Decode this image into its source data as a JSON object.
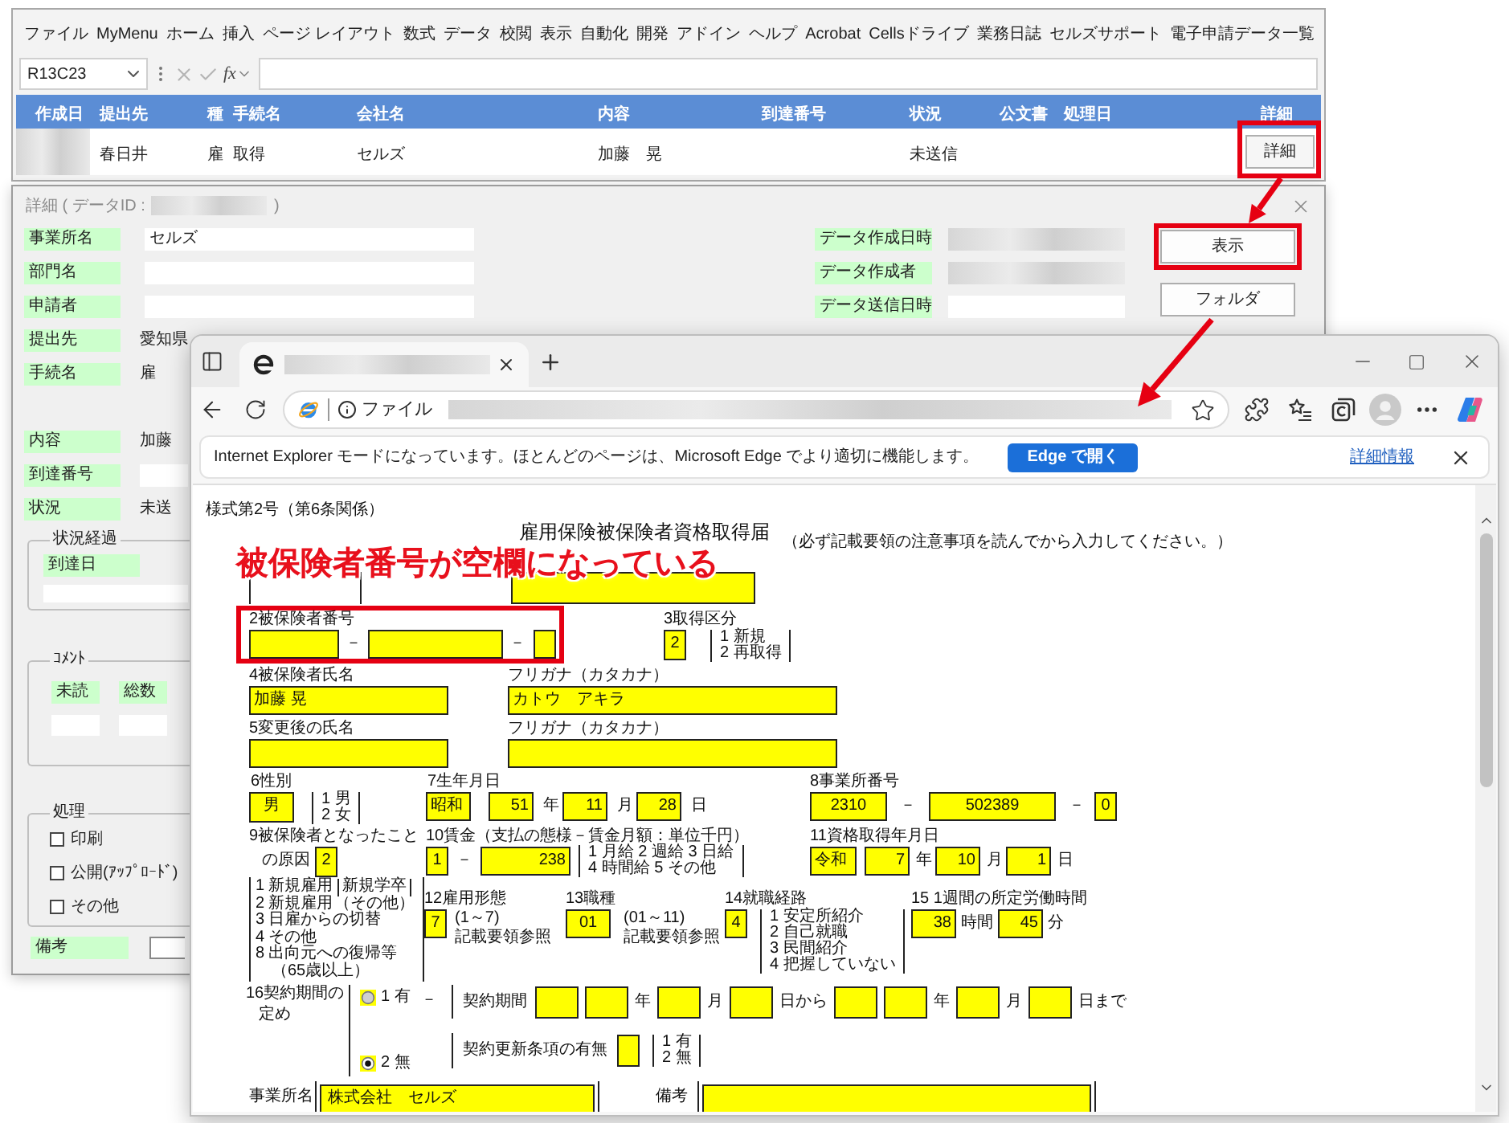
{
  "excel": {
    "menu": [
      "ファイル",
      "MyMenu",
      "ホーム",
      "挿入",
      "ページ レイアウト",
      "数式",
      "データ",
      "校閲",
      "表示",
      "自動化",
      "開発",
      "アドイン",
      "ヘルプ",
      "Acrobat",
      "Cellsドライブ",
      "業務日誌",
      "セルズサポート",
      "電子申請データ一覧"
    ],
    "name_box": "R13C23",
    "formula_label": "fx",
    "columns": [
      "作成日",
      "提出先",
      "種",
      "手続名",
      "会社名",
      "内容",
      "到達番号",
      "状況",
      "公文書",
      "処理日",
      "詳細"
    ],
    "rows": [
      {
        "submitted_to": "春日井",
        "type": "雇",
        "procedure": "取得",
        "company": "セルズ",
        "content": "加藤　晃",
        "status": "未送信",
        "detail_button": "詳細",
        "highlighted": true
      }
    ]
  },
  "detail_dialog": {
    "title": "詳細 ( データID :",
    "title_end": ")",
    "top_fields": [
      {
        "label": "事業所名",
        "value": "セルズ",
        "kind": "input"
      },
      {
        "label": "部門名",
        "kind": "input"
      },
      {
        "label": "申請者",
        "kind": "input"
      }
    ],
    "info_fields": [
      {
        "label": "データ作成日時",
        "kind": "blurred"
      },
      {
        "label": "データ作成者",
        "kind": "blurred"
      },
      {
        "label": "データ送信日時",
        "kind": "input"
      }
    ],
    "buttons": [
      {
        "label": "表示",
        "highlighted": true
      },
      {
        "label": "フォルダ",
        "highlighted": false
      }
    ],
    "field_groups": [
      [
        {
          "label": "提出先",
          "value": "愛知県",
          "kind": "text"
        },
        {
          "label": "手続名",
          "value": "雇",
          "kind": "text"
        }
      ],
      [
        {
          "label": "内容",
          "value": "加藤",
          "kind": "text"
        },
        {
          "label": "到達番号",
          "kind": "input"
        },
        {
          "label": "状況",
          "value": "未送",
          "kind": "text"
        }
      ]
    ],
    "status_history": {
      "title": "状況経過",
      "label": "到達日"
    },
    "comments": {
      "title": "ｺﾒﾝﾄ",
      "labels": [
        "未読",
        "総数"
      ]
    },
    "processing": {
      "title": "処理",
      "options": [
        {
          "label": "印刷",
          "checked": false
        },
        {
          "label": "公開(ｱｯﾌﾟﾛｰﾄﾞ)",
          "checked": false
        },
        {
          "label": "その他",
          "checked": false
        }
      ]
    },
    "remarks": {
      "label": "備考"
    }
  },
  "browser": {
    "address_scheme": "ファイル",
    "info_bar": {
      "message": "Internet Explorer モードになっています。ほとんどのページは、Microsoft Edge でより適切に機能します。",
      "button": "Edge で開く",
      "link": "詳細情報"
    },
    "form": {
      "form_number": "様式第2号（第6条関係）",
      "title": "雇用保険被保険者資格取得届",
      "instruction": "（必ず記載要領の注意事項を読んでから入力してください。）",
      "insured_number": {
        "label": "2被保険者番号",
        "separators": [
          "－",
          "－"
        ],
        "highlighted": true
      },
      "acquisition_type": {
        "label": "3取得区分",
        "value": "2",
        "options": [
          "1 新規",
          "2 再取得"
        ]
      },
      "names": [
        {
          "label": "4被保険者氏名",
          "value": "加藤 晃"
        },
        {
          "label": "フリガナ（カタカナ）",
          "value": "カトウ　アキラ"
        },
        {
          "label": "5変更後の氏名"
        },
        {
          "label": "フリガナ（カタカナ）"
        }
      ],
      "sex": {
        "label": "6性別",
        "value": "男",
        "options": [
          "1 男",
          "2 女"
        ]
      },
      "birth_date": {
        "label": "7生年月日",
        "era": "昭和",
        "parts": [
          {
            "value": "51",
            "unit": "年"
          },
          {
            "value": "11",
            "unit": "月"
          },
          {
            "value": "28",
            "unit": "日"
          }
        ]
      },
      "office_number": {
        "label": "8事業所番号",
        "parts": [
          "2310",
          "502389",
          "0"
        ],
        "separators": [
          "－",
          "－"
        ]
      },
      "reason": {
        "label": "9被保険者となったこと",
        "label_2": "の原因",
        "value": "2",
        "options": [
          {
            "number": "1",
            "label": "新規雇用",
            "note": "新規学卒",
            "kind": "bracketed"
          },
          {
            "number": "2",
            "label": "新規雇用",
            "note": "（その他）",
            "kind": "inline"
          },
          {
            "number": "3",
            "label": "日雇からの切替",
            "kind": "plain"
          },
          {
            "number": "4",
            "label": "その他",
            "kind": "plain"
          },
          {
            "number": "8",
            "label": "出向元への復帰等",
            "note": "（65歳以上）",
            "kind": "below"
          }
        ]
      },
      "wage": {
        "label": "10賃金（支払の態様－賃金月額：単位千円）",
        "type": "1",
        "separator": "－",
        "amount": "238",
        "options": [
          "1 月給 2 週給 3 日給",
          "4 時間給  5 その他"
        ]
      },
      "acquisition_date": {
        "label": "11資格取得年月日",
        "era": "令和",
        "parts": [
          {
            "value": "7",
            "unit": "年"
          },
          {
            "value": "10",
            "unit": "月"
          },
          {
            "value": "1",
            "unit": "日"
          }
        ]
      },
      "codes": [
        {
          "label": "12雇用形態",
          "value": "7",
          "range": "(1～7)",
          "note": "記載要領参照"
        },
        {
          "label": "13職種",
          "value": "01",
          "range": "(01～11)",
          "note": "記載要領参照"
        }
      ],
      "route": {
        "label": "14就職経路",
        "value": "4",
        "options": [
          "1 安定所紹介",
          "2 自己就職",
          "3 民間紹介",
          "4 把握していない"
        ]
      },
      "weekly_hours": {
        "label": "15 1週間の所定労働時間",
        "parts": [
          {
            "value": "38",
            "unit": "時間"
          },
          {
            "value": "45",
            "unit": "分"
          }
        ]
      },
      "contract": {
        "label": "16契約期間の",
        "label_2": "定め",
        "choices": [
          {
            "label": "1 有",
            "selected": false
          },
          {
            "label": "2 無",
            "selected": true
          }
        ],
        "separator": "－",
        "period_label": "契約期間",
        "period_units": [
          "年",
          "月",
          "日から",
          "年",
          "月",
          "日まで"
        ],
        "renewal_label": "契約更新条項の有無",
        "renewal_options": [
          "1 有",
          "2 無"
        ]
      },
      "office_name": {
        "label": "事業所名",
        "value": "株式会社　セルズ"
      },
      "remarks": {
        "label": "備考"
      }
    }
  },
  "annotation": {
    "text": "被保険者番号が空欄になっている"
  }
}
